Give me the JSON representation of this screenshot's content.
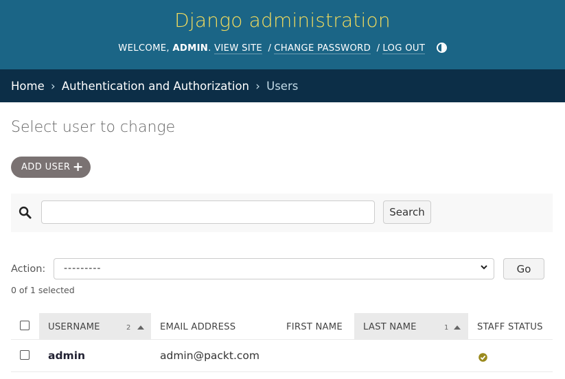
{
  "header": {
    "site_title": "Django administration",
    "welcome": "Welcome,",
    "username": "admin",
    "view_site": "View site",
    "change_password": "Change password",
    "log_out": "Log out",
    "separator": "/",
    "theme_icon": "theme-toggle-icon"
  },
  "breadcrumbs": {
    "home": "Home",
    "app": "Authentication and Authorization",
    "current": "Users",
    "arrow": "›"
  },
  "page": {
    "title": "Select user to change",
    "add_button": "Add user",
    "add_icon": "+"
  },
  "search": {
    "icon": "search-icon",
    "value": "",
    "button": "Search"
  },
  "actions": {
    "label": "Action:",
    "selected_option": "---------",
    "go_button": "Go",
    "selection_count": "0 of 1 selected"
  },
  "table": {
    "columns": [
      {
        "label": "Username",
        "sort_priority": "2",
        "sorted": true,
        "direction": "ascending"
      },
      {
        "label": "Email address",
        "sorted": false
      },
      {
        "label": "First name",
        "sorted": false
      },
      {
        "label": "Last name",
        "sort_priority": "1",
        "sorted": true,
        "direction": "ascending"
      },
      {
        "label": "Staff status",
        "sorted": false
      }
    ],
    "rows": [
      {
        "username": "admin",
        "email": "admin@packt.com",
        "first_name": "",
        "last_name": "",
        "staff_status": true
      }
    ]
  },
  "colors": {
    "header_bg": "#1b6586",
    "title_color": "#f5dd5d",
    "breadcrumb_bg": "#0c2e47",
    "add_button_bg": "#7a7272",
    "staff_check": "#9a8a1e"
  }
}
